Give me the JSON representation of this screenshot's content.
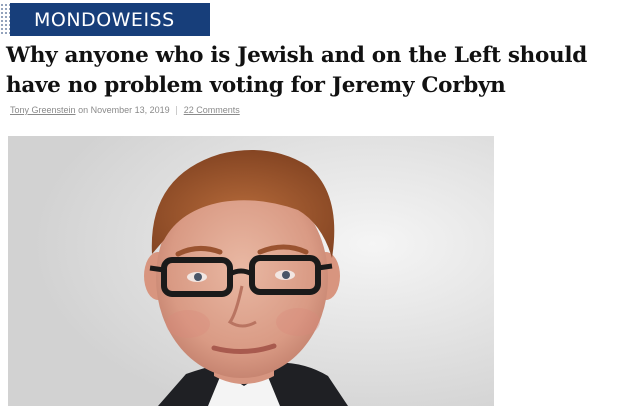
{
  "brand": {
    "name": "MONDOWEISS",
    "color": "#173e7a"
  },
  "article": {
    "title": "Why anyone who is Jewish and on the Left should have no problem voting for Jeremy Corbyn",
    "author": "Tony Greenstein",
    "date_prefix": "on",
    "date": "November 13, 2019",
    "comments": "22 Comments"
  },
  "image": {
    "subject": "portrait of a man with red hair and glasses"
  }
}
